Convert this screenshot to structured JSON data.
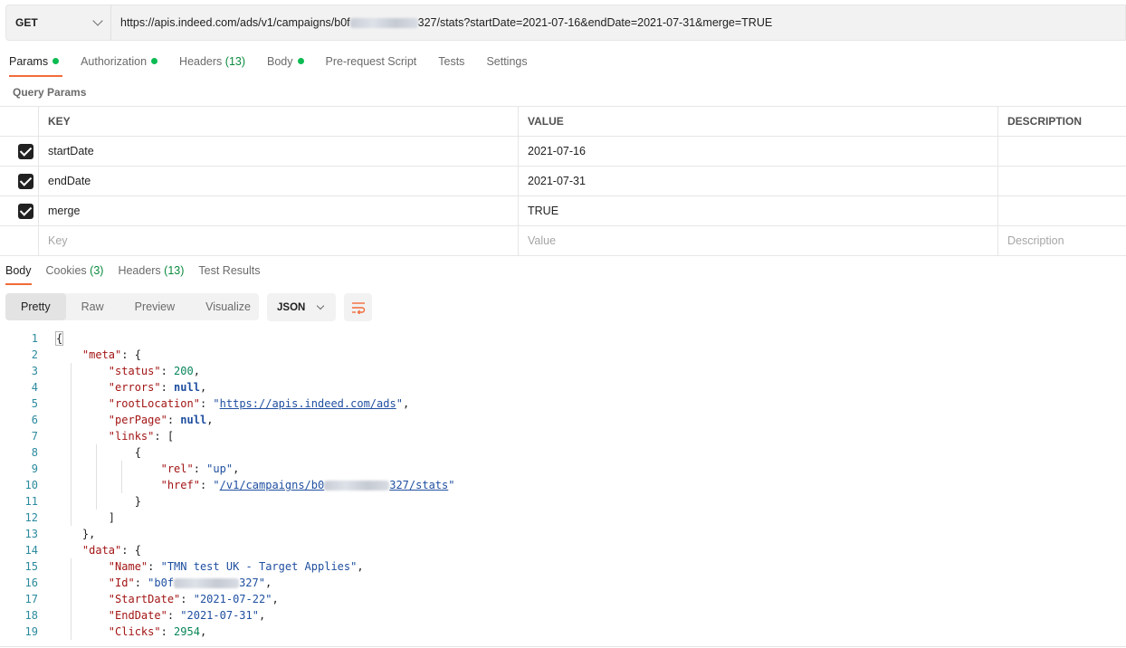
{
  "request": {
    "method": "GET",
    "url_prefix": "https://apis.indeed.com/ads/v1/campaigns/b0f",
    "url_suffix": "327/stats?startDate=2021-07-16&endDate=2021-07-31&merge=TRUE"
  },
  "request_tabs": [
    {
      "label": "Params",
      "dot": true,
      "active": true
    },
    {
      "label": "Authorization",
      "dot": true
    },
    {
      "label": "Headers",
      "count": "(13)"
    },
    {
      "label": "Body",
      "dot": true
    },
    {
      "label": "Pre-request Script"
    },
    {
      "label": "Tests"
    },
    {
      "label": "Settings"
    }
  ],
  "query_params": {
    "title": "Query Params",
    "headers": {
      "key": "KEY",
      "value": "VALUE",
      "description": "DESCRIPTION"
    },
    "rows": [
      {
        "key": "startDate",
        "value": "2021-07-16",
        "checked": true
      },
      {
        "key": "endDate",
        "value": "2021-07-31",
        "checked": true
      },
      {
        "key": "merge",
        "value": "TRUE",
        "checked": true
      }
    ],
    "placeholders": {
      "key": "Key",
      "value": "Value",
      "description": "Description"
    }
  },
  "response_tabs": [
    {
      "label": "Body",
      "active": true
    },
    {
      "label": "Cookies",
      "count": "(3)"
    },
    {
      "label": "Headers",
      "count": "(13)"
    },
    {
      "label": "Test Results"
    }
  ],
  "view_modes": [
    "Pretty",
    "Raw",
    "Preview",
    "Visualize"
  ],
  "active_view": "Pretty",
  "format": "JSON",
  "icons": {
    "method_dropdown": "chevron-down-icon",
    "format_dropdown": "chevron-down-icon",
    "wrap": "wrap-lines-icon",
    "checkbox": "checkbox-checked-icon"
  },
  "colors": {
    "accent": "#f26b3a",
    "status_dot": "#0cbb52",
    "count": "#0a8a3e"
  },
  "code": {
    "lines": [
      {
        "n": "1",
        "tokens": [
          [
            "p",
            "{"
          ]
        ]
      },
      {
        "n": "2",
        "tokens": [
          [
            "p",
            "    "
          ],
          [
            "key",
            "\"meta\""
          ],
          [
            "p",
            ": {"
          ]
        ]
      },
      {
        "n": "3",
        "tokens": [
          [
            "p",
            "        "
          ],
          [
            "key",
            "\"status\""
          ],
          [
            "p",
            ": "
          ],
          [
            "num",
            "200"
          ],
          [
            "p",
            ","
          ]
        ]
      },
      {
        "n": "4",
        "tokens": [
          [
            "p",
            "        "
          ],
          [
            "key",
            "\"errors\""
          ],
          [
            "p",
            ": "
          ],
          [
            "kw",
            "null"
          ],
          [
            "p",
            ","
          ]
        ]
      },
      {
        "n": "5",
        "tokens": [
          [
            "p",
            "        "
          ],
          [
            "key",
            "\"rootLocation\""
          ],
          [
            "p",
            ": "
          ],
          [
            "str",
            "\""
          ],
          [
            "link",
            "https://apis.indeed.com/ads"
          ],
          [
            "str",
            "\""
          ],
          [
            "p",
            ","
          ]
        ]
      },
      {
        "n": "6",
        "tokens": [
          [
            "p",
            "        "
          ],
          [
            "key",
            "\"perPage\""
          ],
          [
            "p",
            ": "
          ],
          [
            "kw",
            "null"
          ],
          [
            "p",
            ","
          ]
        ]
      },
      {
        "n": "7",
        "tokens": [
          [
            "p",
            "        "
          ],
          [
            "key",
            "\"links\""
          ],
          [
            "p",
            ": ["
          ]
        ]
      },
      {
        "n": "8",
        "tokens": [
          [
            "p",
            "            {"
          ]
        ]
      },
      {
        "n": "9",
        "tokens": [
          [
            "p",
            "                "
          ],
          [
            "key",
            "\"rel\""
          ],
          [
            "p",
            ": "
          ],
          [
            "str",
            "\"up\""
          ],
          [
            "p",
            ","
          ]
        ]
      },
      {
        "n": "10",
        "tokens": [
          [
            "p",
            "                "
          ],
          [
            "key",
            "\"href\""
          ],
          [
            "p",
            ": "
          ],
          [
            "str",
            "\""
          ],
          [
            "link",
            "/v1/campaigns/b0"
          ],
          [
            "blur",
            ""
          ],
          [
            "link",
            "327/stats"
          ],
          [
            "str",
            "\""
          ]
        ]
      },
      {
        "n": "11",
        "tokens": [
          [
            "p",
            "            }"
          ]
        ]
      },
      {
        "n": "12",
        "tokens": [
          [
            "p",
            "        ]"
          ]
        ]
      },
      {
        "n": "13",
        "tokens": [
          [
            "p",
            "    },"
          ]
        ]
      },
      {
        "n": "14",
        "tokens": [
          [
            "p",
            "    "
          ],
          [
            "key",
            "\"data\""
          ],
          [
            "p",
            ": {"
          ]
        ]
      },
      {
        "n": "15",
        "tokens": [
          [
            "p",
            "        "
          ],
          [
            "key",
            "\"Name\""
          ],
          [
            "p",
            ": "
          ],
          [
            "str",
            "\"TMN test UK - Target Applies\""
          ],
          [
            "p",
            ","
          ]
        ]
      },
      {
        "n": "16",
        "tokens": [
          [
            "p",
            "        "
          ],
          [
            "key",
            "\"Id\""
          ],
          [
            "p",
            ": "
          ],
          [
            "str",
            "\"b0f"
          ],
          [
            "blur",
            ""
          ],
          [
            "str",
            "327\""
          ],
          [
            "p",
            ","
          ]
        ]
      },
      {
        "n": "17",
        "tokens": [
          [
            "p",
            "        "
          ],
          [
            "key",
            "\"StartDate\""
          ],
          [
            "p",
            ": "
          ],
          [
            "str",
            "\"2021-07-22\""
          ],
          [
            "p",
            ","
          ]
        ]
      },
      {
        "n": "18",
        "tokens": [
          [
            "p",
            "        "
          ],
          [
            "key",
            "\"EndDate\""
          ],
          [
            "p",
            ": "
          ],
          [
            "str",
            "\"2021-07-31\""
          ],
          [
            "p",
            ","
          ]
        ]
      },
      {
        "n": "19",
        "tokens": [
          [
            "p",
            "        "
          ],
          [
            "key",
            "\"Clicks\""
          ],
          [
            "p",
            ": "
          ],
          [
            "num",
            "2954"
          ],
          [
            "p",
            ","
          ]
        ]
      }
    ]
  }
}
